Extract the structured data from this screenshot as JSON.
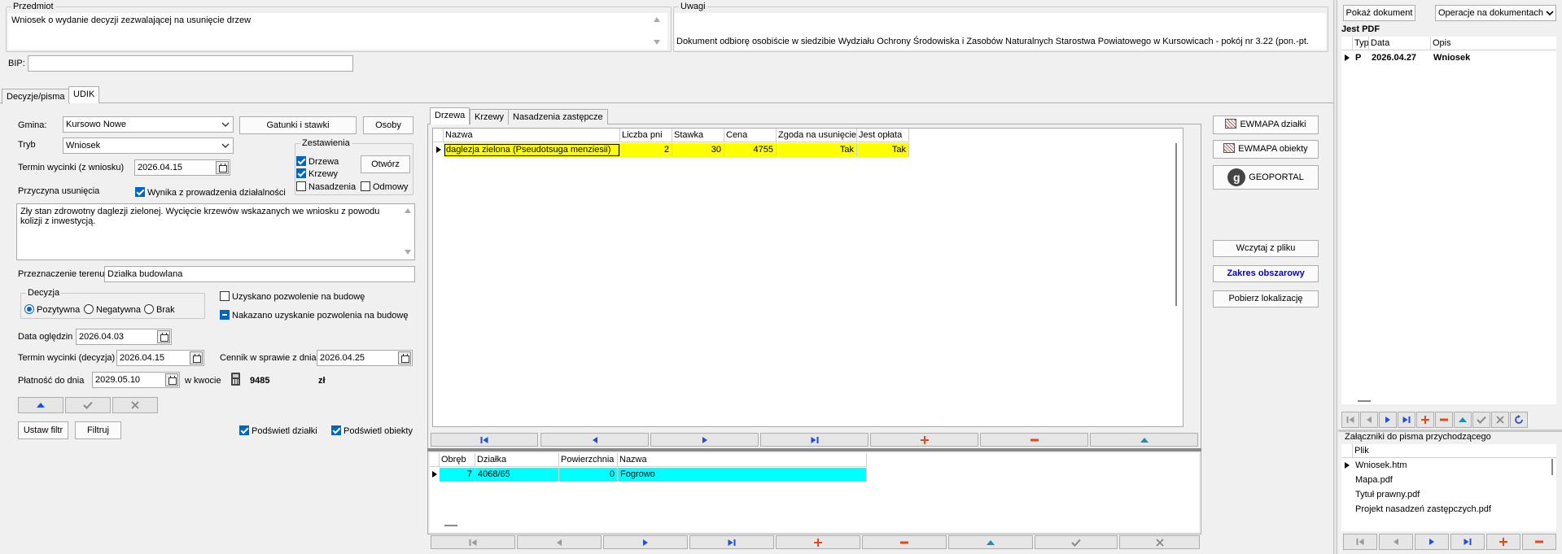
{
  "top": {
    "przedmiot_legend": "Przedmiot",
    "przedmiot_text": "Wniosek o wydanie decyzji zezwalającej na usunięcie drzew",
    "uwagi_legend": "Uwagi",
    "uwagi_text": "Dokument odbiorę osobiście w siedzibie Wydziału Ochrony Środowiska i Zasobów Naturalnych Starostwa Powiatowego w Kursowicach - pokój nr 3.22 (pon.-pt.",
    "bip_label": "BIP:",
    "bip_value": ""
  },
  "main_tabs": [
    "Decyzje/pisma",
    "UDIK"
  ],
  "form": {
    "gmina_label": "Gmina:",
    "gmina_value": "Kursowo Nowe",
    "gatunki_button": "Gatunki i stawki",
    "osoby_button": "Osoby",
    "tryb_label": "Tryb",
    "tryb_value": "Wniosek",
    "termin_wycinki_wn_label": "Termin wycinki (z wniosku)",
    "termin_wycinki_wn_value": "2026.04.15",
    "zestawienia_legend": "Zestawienia",
    "drzewa_label": "Drzewa",
    "krzewy_label": "Krzewy",
    "nasadzenia_label": "Nasadzenia",
    "odmowy_label": "Odmowy",
    "otworz_button": "Otwórz",
    "przyczyna_label": "Przyczyna usunięcia",
    "wynika_label": "Wynika z prowadzenia działalności",
    "przyczyna_text": "Zły stan zdrowotny daglezji zielonej. Wycięcie krzewów wskazanych we wniosku z powodu kolizji z inwestycją.",
    "przeznaczenie_label": "Przeznaczenie terenu",
    "przeznaczenie_value": "Działka budowlana",
    "decyzja_legend": "Decyzja",
    "pozytywna_label": "Pozytywna",
    "negatywna_label": "Negatywna",
    "brak_label": "Brak",
    "uzyskano_label": "Uzyskano pozwolenie na budowę",
    "nakazano_label": "Nakazano uzyskanie pozwolenia na budowę",
    "data_ogledzin_label": "Data oględzin",
    "data_ogledzin_value": "2026.04.03",
    "termin_wycinki_dec_label": "Termin wycinki (decyzja)",
    "termin_wycinki_dec_value": "2026.04.15",
    "cennik_label": "Cennik w sprawie z dnia",
    "cennik_value": "2026.04.25",
    "platnosc_label": "Płatność do dnia",
    "platnosc_value": "2029.05.10",
    "w_kwocie_label": "w kwocie",
    "kwota_value": "9485",
    "waluta": "zł",
    "ustaw_filtr_button": "Ustaw filtr",
    "filtruj_button": "Filtruj",
    "podswietl_dzialki_label": "Podświetl działki",
    "podswietl_obiekty_label": "Podświetl obiekty"
  },
  "inner_tabs": [
    "Drzewa",
    "Krzewy",
    "Nasadzenia zastępcze"
  ],
  "drzewa_grid": {
    "columns": [
      "Nazwa",
      "Liczba pni",
      "Stawka",
      "Cena",
      "Zgoda na usunięcie",
      "Jest opłata"
    ],
    "rows": [
      [
        "daglezja zielona (Pseudotsuga menziesii)",
        "2",
        "30",
        "4755",
        "Tak",
        "Tak"
      ]
    ]
  },
  "dzialki_grid": {
    "columns": [
      "Obręb",
      "Działka",
      "Powierzchnia",
      "Nazwa"
    ],
    "rows": [
      [
        "7",
        "4068/65",
        "0",
        "Fogrowo"
      ]
    ]
  },
  "map_buttons": {
    "ewmapa_dzialki": "EWMAPA działki",
    "ewmapa_obiekty": "EWMAPA obiekty",
    "geoportal": "GEOPORTAL",
    "geo_glyph": "g",
    "wczytaj": "Wczytaj z pliku",
    "zakres": "Zakres obszarowy",
    "pobierz": "Pobierz lokalizację"
  },
  "right_panel": {
    "pokaz_button": "Pokaż dokument",
    "operacje_button": "Operacje na dokumentach",
    "jest_pdf": "Jest PDF",
    "doc_columns": [
      "Typ",
      "Data",
      "Opis"
    ],
    "doc_rows": [
      [
        "P",
        "2026.04.27",
        "Wniosek"
      ]
    ],
    "zalaczniki_label": "Załączniki do pisma przychodzącego",
    "plik_column": "Plik",
    "files": [
      "Wniosek.htm",
      "Mapa.pdf",
      "Tytuł prawny.pdf",
      "Projekt nasadzeń zastępczych.pdf"
    ]
  },
  "colors": {
    "row_highlight_yellow": "#ffff00",
    "row_highlight_cyan": "#00ffff",
    "accent_blue": "#0067c0",
    "zakres_text": "#0000e0"
  }
}
